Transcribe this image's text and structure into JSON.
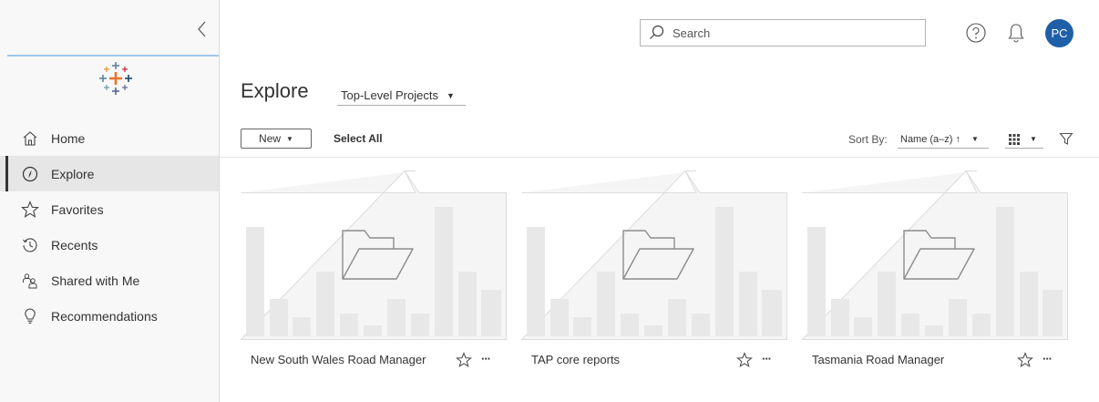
{
  "sidebar": {
    "items": [
      {
        "label": "Home",
        "icon": "home-icon"
      },
      {
        "label": "Explore",
        "icon": "explore-icon",
        "active": true
      },
      {
        "label": "Favorites",
        "icon": "star-icon"
      },
      {
        "label": "Recents",
        "icon": "recents-icon"
      },
      {
        "label": "Shared with Me",
        "icon": "shared-icon"
      },
      {
        "label": "Recommendations",
        "icon": "lightbulb-icon"
      }
    ]
  },
  "header": {
    "search_placeholder": "Search",
    "avatar_initials": "PC"
  },
  "main": {
    "title": "Explore",
    "project_filter": "Top-Level Projects",
    "new_label": "New",
    "select_all_label": "Select All",
    "sort_label": "Sort By:",
    "sort_value": "Name (a–z)",
    "sort_arrow": "↑"
  },
  "cards": [
    {
      "name": "New South Wales Road Manager"
    },
    {
      "name": "TAP core reports"
    },
    {
      "name": "Tasmania Road Manager"
    }
  ],
  "colors": {
    "accent": "#1f5fa8",
    "sidebar_bg": "#f8f8f8",
    "active_bg": "#e6e6e6",
    "thumb_bg": "#f5f5f5",
    "thumb_bar": "#e8e8e8"
  }
}
